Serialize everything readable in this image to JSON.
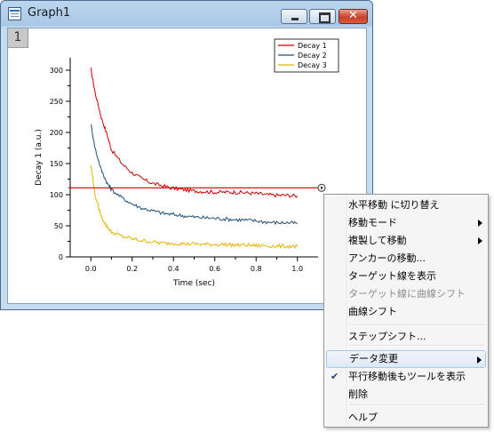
{
  "window": {
    "title": "Graph1",
    "layer_label": "1",
    "close_glyph": "✕",
    "icons": [
      "graph-window-icon",
      "minimize-icon",
      "maximize-icon",
      "close-icon"
    ]
  },
  "chart_data": {
    "type": "line",
    "xlabel": "Time (sec)",
    "ylabel": "Decay 1 (a.u.)",
    "xlim": [
      -0.1,
      1.1
    ],
    "ylim": [
      0,
      320
    ],
    "x_ticks": [
      "0.0",
      "0.2",
      "0.4",
      "0.6",
      "0.8",
      "1.0"
    ],
    "y_ticks": [
      "0",
      "50",
      "100",
      "150",
      "200",
      "250",
      "300"
    ],
    "legend_position": "top-right",
    "grid": false,
    "series": [
      {
        "name": "Decay 1",
        "color": "#cc0000",
        "x": [
          0.0,
          0.02,
          0.05,
          0.08,
          0.1,
          0.15,
          0.2,
          0.25,
          0.3,
          0.35,
          0.4,
          0.45,
          0.5,
          0.55,
          0.6,
          0.65,
          0.7,
          0.75,
          0.8,
          0.85,
          0.9,
          0.95,
          1.0
        ],
        "y": [
          302,
          265,
          225,
          195,
          172,
          150,
          135,
          125,
          118,
          114,
          110,
          108,
          106,
          105,
          104,
          104,
          104,
          103,
          102,
          100,
          99,
          99,
          98
        ]
      },
      {
        "name": "Decay 2",
        "color": "#1f4e79",
        "x": [
          0.0,
          0.02,
          0.05,
          0.08,
          0.1,
          0.15,
          0.2,
          0.25,
          0.3,
          0.35,
          0.4,
          0.45,
          0.5,
          0.55,
          0.6,
          0.65,
          0.7,
          0.75,
          0.8,
          0.85,
          0.9,
          0.95,
          1.0
        ],
        "y": [
          215,
          175,
          140,
          118,
          108,
          95,
          85,
          78,
          74,
          70,
          68,
          66,
          64,
          63,
          62,
          61,
          60,
          59,
          58,
          56,
          55,
          55,
          54
        ]
      },
      {
        "name": "Decay 3",
        "color": "#e8b400",
        "x": [
          0.0,
          0.02,
          0.05,
          0.08,
          0.1,
          0.15,
          0.2,
          0.25,
          0.3,
          0.35,
          0.4,
          0.45,
          0.5,
          0.55,
          0.6,
          0.65,
          0.7,
          0.75,
          0.8,
          0.85,
          0.9,
          0.95,
          1.0
        ],
        "y": [
          148,
          100,
          65,
          48,
          40,
          33,
          29,
          26,
          24,
          22,
          22,
          21,
          21,
          20,
          20,
          20,
          19,
          19,
          18,
          18,
          17,
          17,
          17
        ]
      }
    ],
    "annotations": [
      {
        "type": "horizontal-line",
        "y": 111,
        "color": "#cc0000"
      }
    ]
  },
  "menu": {
    "items": [
      {
        "label": "水平移動 に切り替え",
        "has_submenu": false,
        "disabled": false
      },
      {
        "label": "移動モード",
        "has_submenu": true,
        "disabled": false
      },
      {
        "label": "複製して移動",
        "has_submenu": true,
        "disabled": false
      },
      {
        "label": "アンカーの移動...",
        "has_submenu": false,
        "disabled": false
      },
      {
        "label": "ターゲット線を表示",
        "has_submenu": false,
        "disabled": false
      },
      {
        "label": "ターゲット線に曲線シフト",
        "has_submenu": false,
        "disabled": true
      },
      {
        "label": "曲線シフト",
        "has_submenu": false,
        "disabled": false
      },
      {
        "label": "ステップシフト...",
        "has_submenu": false,
        "disabled": false
      },
      {
        "label": "データ変更",
        "has_submenu": true,
        "disabled": false,
        "highlighted": true
      },
      {
        "label": "平行移動後もツールを表示",
        "has_submenu": false,
        "disabled": false,
        "checked": true
      },
      {
        "label": "削除",
        "has_submenu": false,
        "disabled": false
      },
      {
        "label": "ヘルプ",
        "has_submenu": false,
        "disabled": false
      }
    ],
    "check_glyph": "✔",
    "highlight_color": "#dde9f6"
  }
}
